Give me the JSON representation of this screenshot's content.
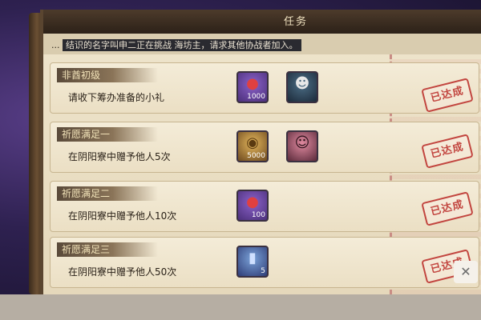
{
  "panel": {
    "title": "任务",
    "marquee": {
      "prefix": "...",
      "highlight": "结识的名字叫申二正在挑战 海坊主，请求其他协战者加入。"
    }
  },
  "tasks": [
    {
      "tag": "非酋初级",
      "desc": "请收下筹办准备的小礼",
      "rewards": [
        {
          "icon": "red-daruma-icon",
          "count": "1000",
          "style": "purple",
          "glyph": "●"
        },
        {
          "icon": "ghost-mask-icon",
          "count": "",
          "style": "ghost",
          "glyph": "☻"
        }
      ],
      "stamp": "已达成"
    },
    {
      "tag": "祈愿满足一",
      "desc": "在阴阳寮中赠予他人5次",
      "rewards": [
        {
          "icon": "gold-coin-icon",
          "count": "5000",
          "style": "gold",
          "glyph": "◉"
        },
        {
          "icon": "shikigami-portrait-icon",
          "count": "",
          "style": "girl",
          "glyph": "☺"
        }
      ],
      "stamp": "已达成"
    },
    {
      "tag": "祈愿满足二",
      "desc": "在阴阳寮中赠予他人10次",
      "rewards": [
        {
          "icon": "red-daruma-icon",
          "count": "100",
          "style": "purple",
          "glyph": "●"
        }
      ],
      "stamp": "已达成"
    },
    {
      "tag": "祈愿满足三",
      "desc": "在阴阳寮中赠予他人50次",
      "rewards": [
        {
          "icon": "blue-talisman-icon",
          "count": "5",
          "style": "blue",
          "glyph": "▮"
        }
      ],
      "stamp": "已达成"
    }
  ],
  "close_glyph": "✕"
}
